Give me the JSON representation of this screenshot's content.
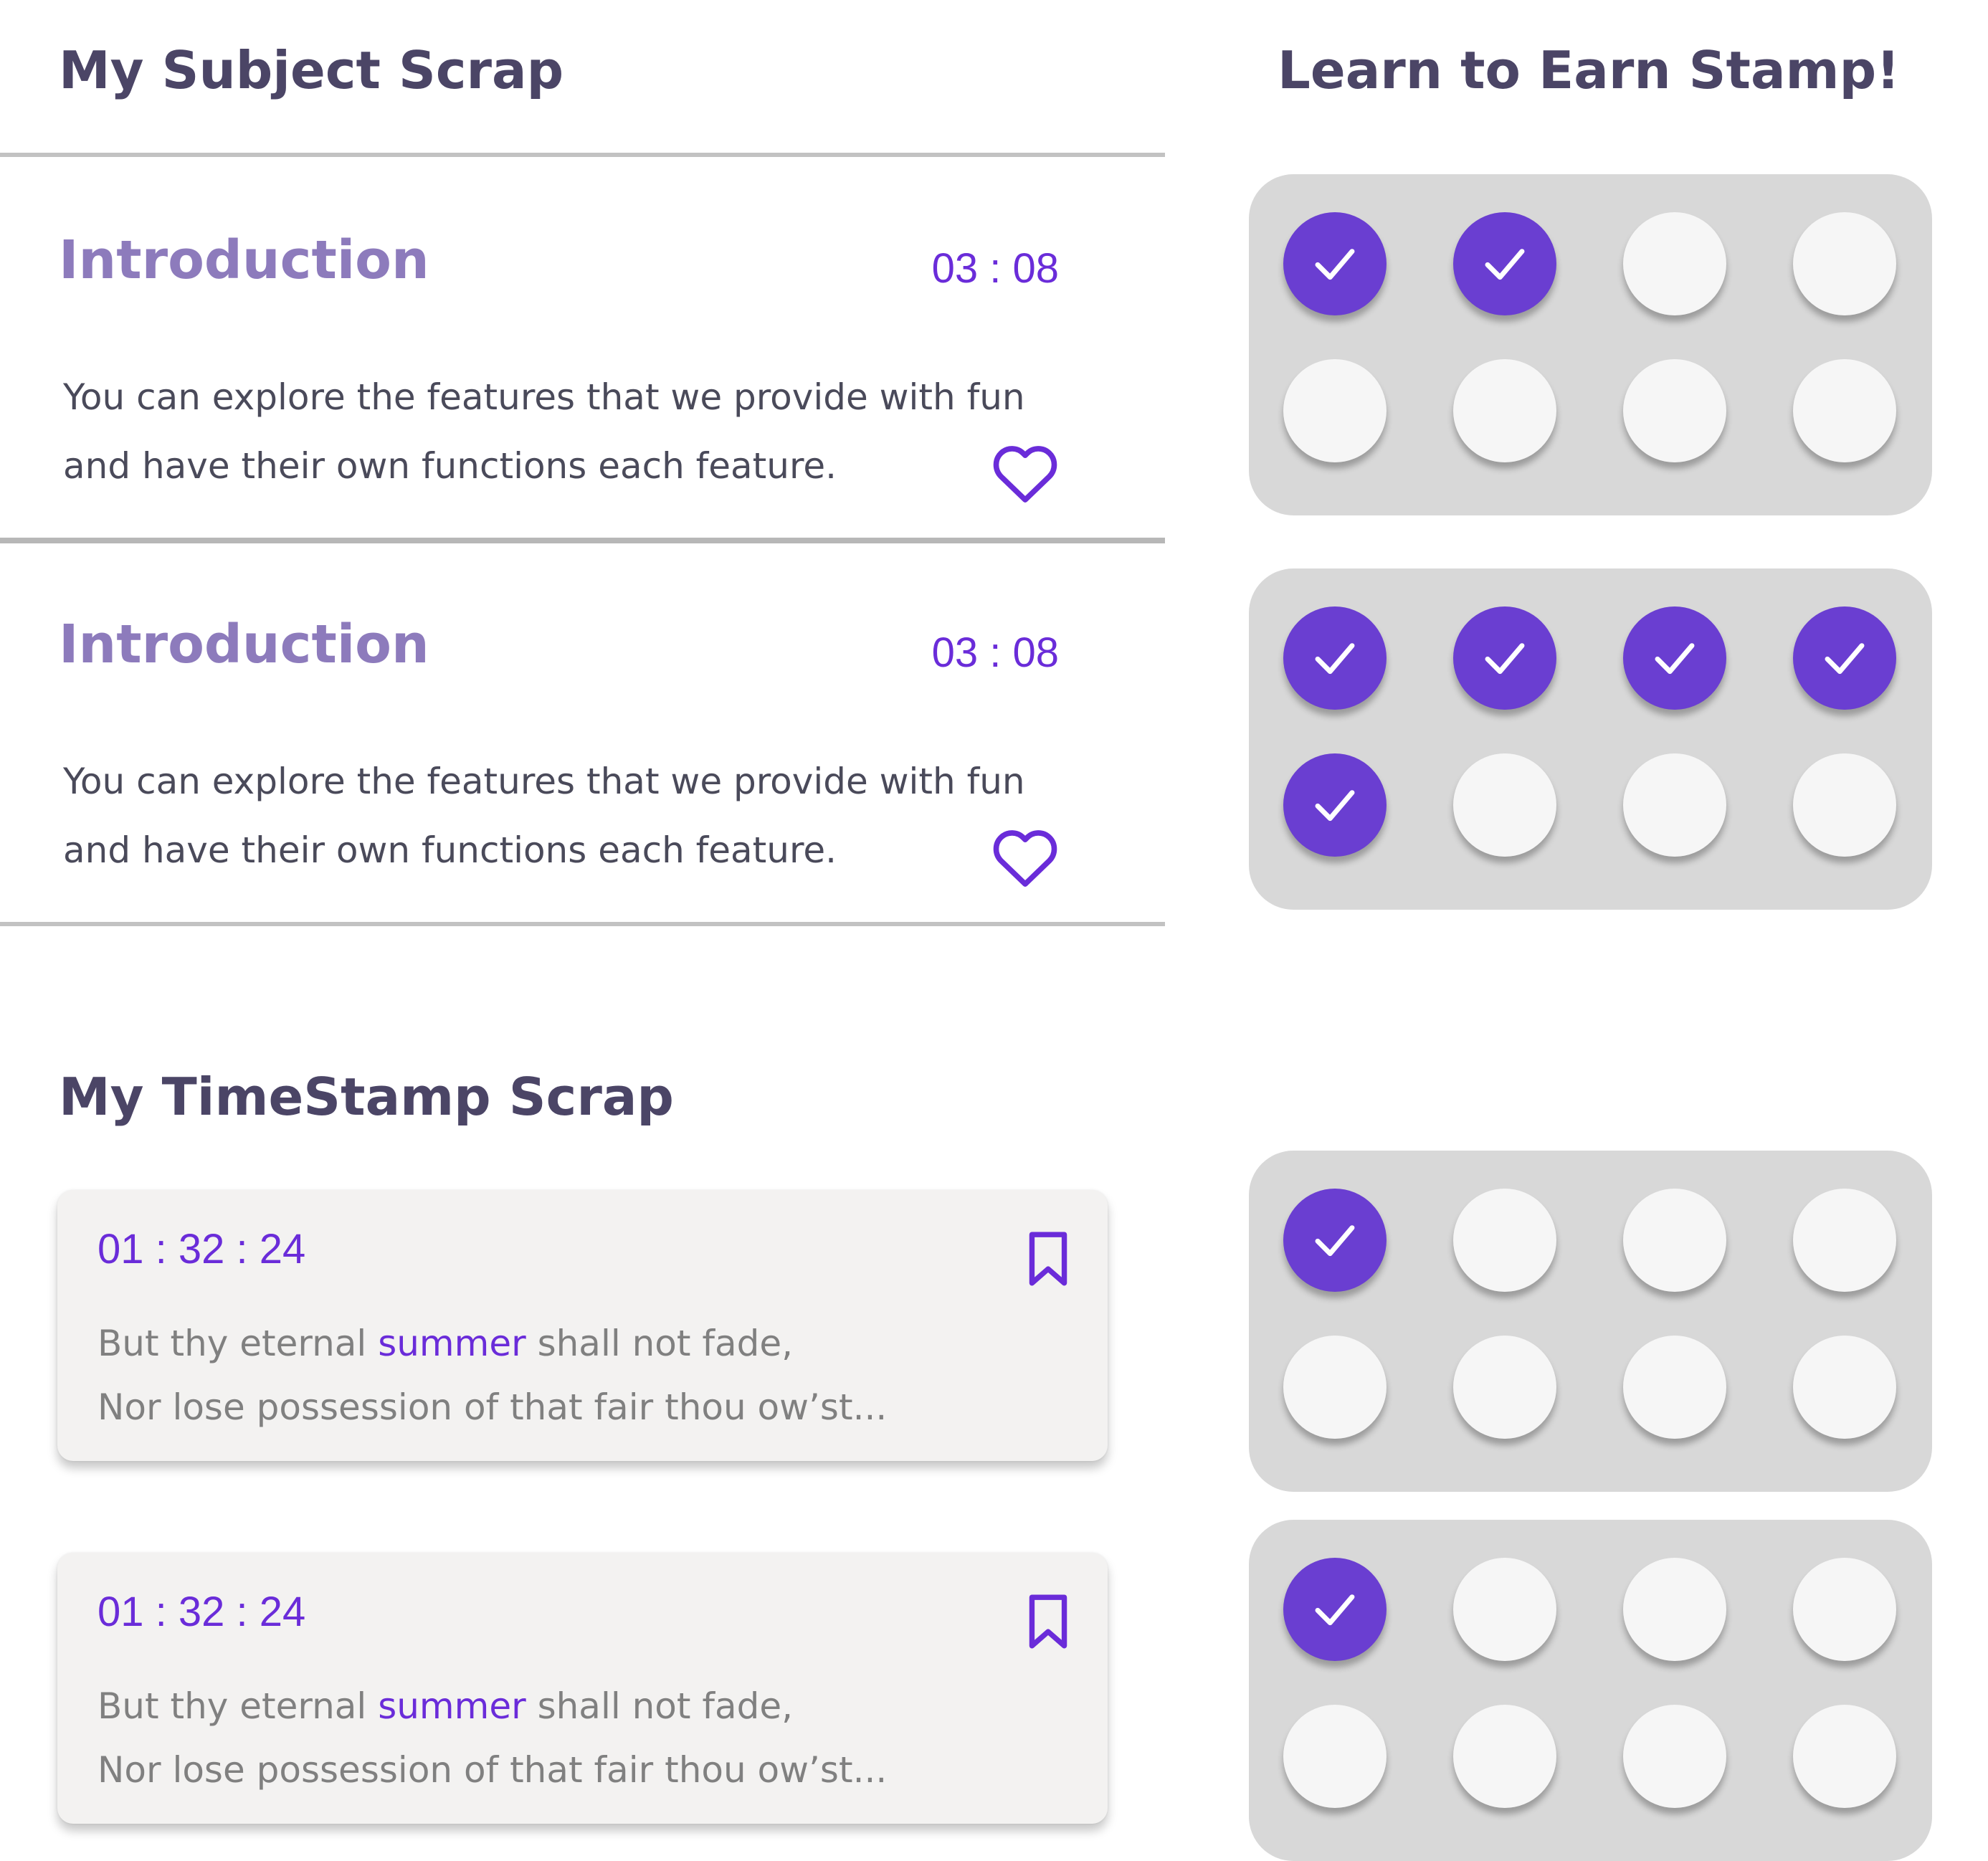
{
  "subject_scrap": {
    "title": "My Subject Scrap",
    "items": [
      {
        "title": "Introduction",
        "time": "03 : 08",
        "description_lines": [
          "You can explore the features that we provide with fun",
          "and have their own functions each feature."
        ],
        "icon": "heart-icon"
      },
      {
        "title": "Introduction",
        "time": "03 : 08",
        "description_lines": [
          "You can explore the features that we provide with fun",
          "and have their own functions each feature."
        ],
        "icon": "heart-icon"
      }
    ]
  },
  "timestamp_scrap": {
    "title": "My TimeStamp Scrap",
    "items": [
      {
        "time": "01 : 32 : 24",
        "line1_before": "But thy eternal ",
        "line1_highlight": "summer",
        "line1_after": " shall not fade,",
        "line2": "Nor lose possession of that fair thou ow’st...",
        "icon": "bookmark-icon"
      },
      {
        "time": "01 : 32 : 24",
        "line1_before": "But thy eternal ",
        "line1_highlight": "summer",
        "line1_after": " shall not fade,",
        "line2": "Nor lose possession of that fair thou ow’st...",
        "icon": "bookmark-icon"
      }
    ]
  },
  "stamps": {
    "title": "Learn to Earn Stamp!",
    "slots_per_card": 8,
    "cards": [
      {
        "earned": 2
      },
      {
        "earned": 5
      },
      {
        "earned": 1
      },
      {
        "earned": 1
      }
    ]
  },
  "colors": {
    "accent": "#6a3ed1",
    "accent_text": "#6a2cd9",
    "heading": "#4b4566",
    "subject_title": "#8d7bbc",
    "stamp_panel": "#d8d8d8",
    "stamp_empty": "#f6f6f6",
    "card_bg": "#f3f2f1"
  }
}
